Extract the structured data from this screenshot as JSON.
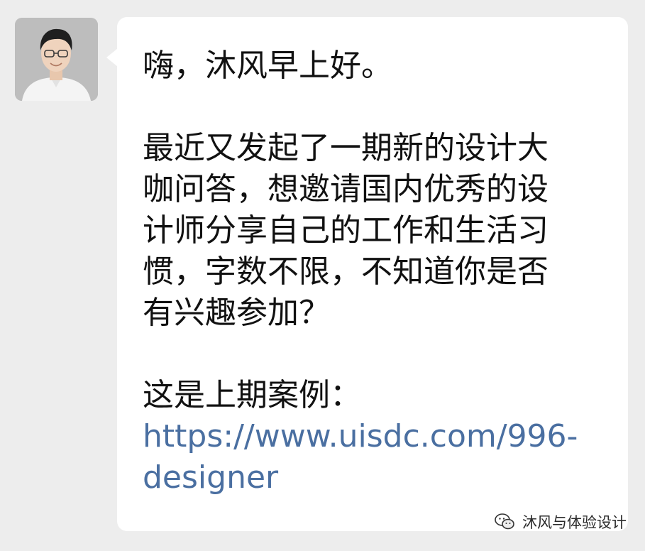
{
  "sender": {
    "avatar_icon": "person-avatar"
  },
  "message": {
    "greeting": "嗨，沐风早上好。",
    "body_lines": [
      "最近又发起了一期新的设计大",
      "咖问答，想邀请国内优秀的设",
      "计师分享自己的工作和生活习",
      "惯，字数不限，不知道你是否",
      "有兴趣参加？"
    ],
    "case_label": "这是上期案例：",
    "link_lines": [
      "https://www.uisdc.com/996-",
      "designer"
    ]
  },
  "watermark": {
    "icon": "wechat-icon",
    "text": "沐风与体验设计"
  },
  "colors": {
    "background": "#ededed",
    "bubble": "#ffffff",
    "text": "#111111",
    "link": "#4a6fa1"
  }
}
